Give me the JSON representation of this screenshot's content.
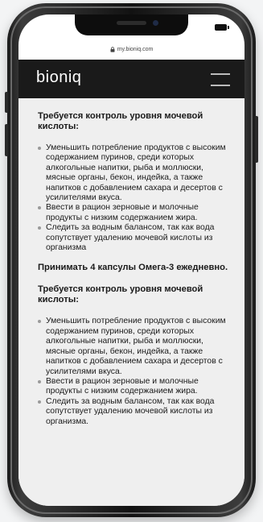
{
  "browser": {
    "url": "my.bioniq.com"
  },
  "header": {
    "logo": "bioniq"
  },
  "content": {
    "section1": {
      "heading": "Требуется контроль уровня мочевой кислоты:",
      "items": [
        "Уменьшить потребление продуктов с высоким содержанием пуринов, среди которых алкогольные напитки, рыба и моллюски, мясные органы, бекон, индейка, а также напитков с добавлением сахара и десертов с усилителями вкуса.",
        "Ввести в рацион зерновые и молочные продукты с низким содержанием жира.",
        "Следить за водным балансом, так как вода сопутствует удалению мочевой кислоты из организма"
      ]
    },
    "omega_note": "Принимать 4 капсулы Омега-3 ежедневно.",
    "section2": {
      "heading": "Требуется контроль уровня мочевой кислоты:",
      "items": [
        "Уменьшить потребление продуктов с высоким содержанием пуринов, среди которых алкогольные напитки, рыба и моллюски, мясные органы, бекон, индейка, а также напитков с добавлением сахара и десертов с усилителями вкуса.",
        "Ввести в рацион зерновые и молочные продукты с низким содержанием жира.",
        "Следить за водным балансом, так как вода сопутствует удалению мочевой кислоты из организма."
      ]
    }
  },
  "colors": {
    "header_bg": "#1a1a1a",
    "content_bg": "#efefef",
    "text": "#1a1a1a"
  },
  "icons": [
    "lock-icon",
    "battery-icon",
    "menu-icon"
  ]
}
